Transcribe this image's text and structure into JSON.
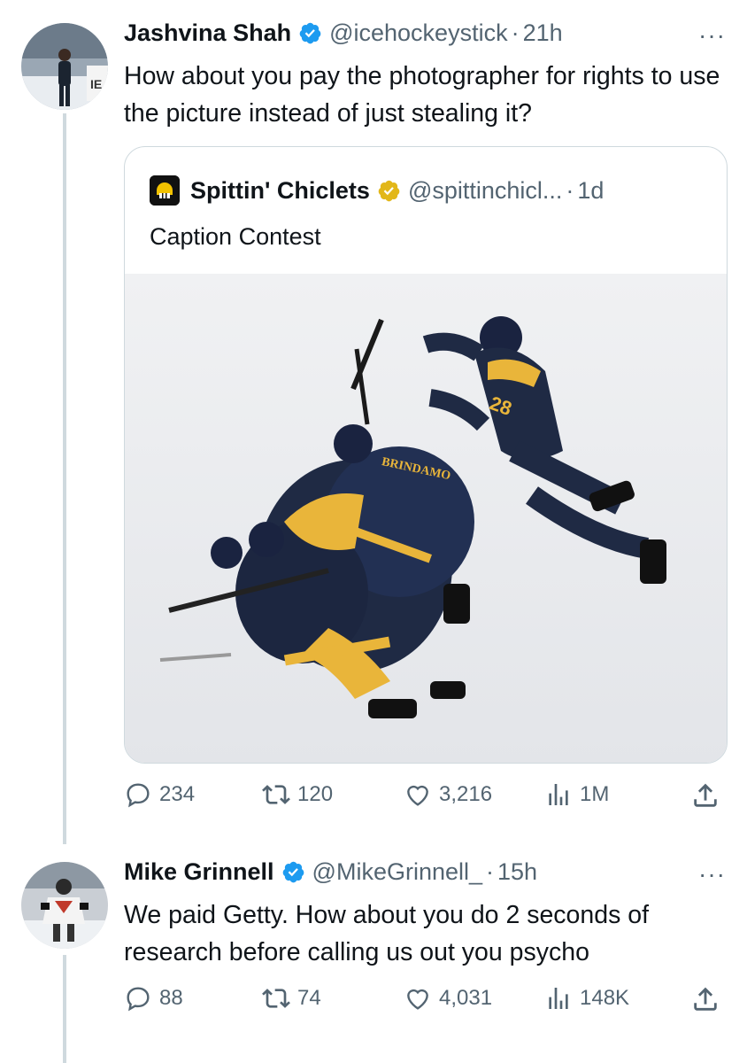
{
  "tweet1": {
    "name": "Jashvina Shah",
    "handle": "@icehockeystick",
    "time": "21h",
    "text": "How about you pay the photographer for rights to use the picture instead of just stealing it?",
    "quote": {
      "name": "Spittin' Chiclets",
      "handle": "@spittinchicl...",
      "time": "1d",
      "text": "Caption Contest"
    },
    "stats": {
      "replies": "234",
      "reposts": "120",
      "likes": "3,216",
      "views": "1M"
    }
  },
  "tweet2": {
    "name": "Mike Grinnell",
    "handle": "@MikeGrinnell_",
    "time": "15h",
    "text": "We paid Getty. How about you do 2 seconds of research before calling us out you psycho",
    "stats": {
      "replies": "88",
      "reposts": "74",
      "likes": "4,031",
      "views": "148K"
    }
  },
  "icons": {
    "reply": "reply-icon",
    "repost": "repost-icon",
    "like": "heart-icon",
    "views": "views-icon",
    "share": "share-icon",
    "more": "more-icon",
    "verified": "verified-badge-icon"
  },
  "colors": {
    "verified_blue": "#1d9bf0",
    "verified_gold": "#e2b719",
    "text_secondary": "#536471",
    "border": "#cfd9de"
  }
}
